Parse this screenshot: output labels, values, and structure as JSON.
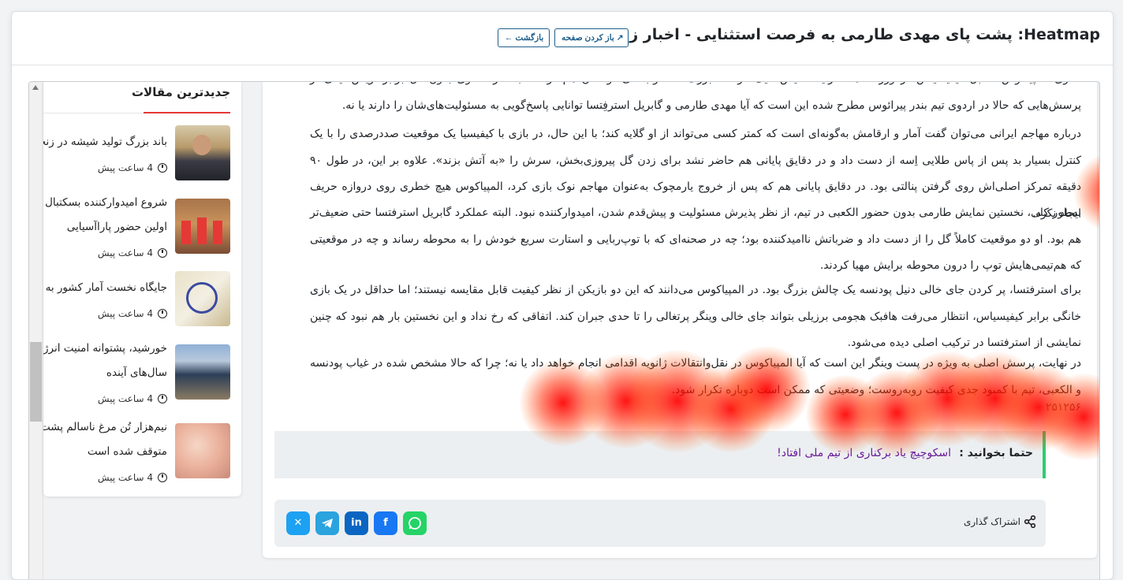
{
  "header": {
    "title": "Heatmap: پشت پای مهدی طارمی به فرصت استثنایی - اخبار زنده",
    "open_page_label": "باز کردن صفحه ↗",
    "back_label": "← بازگشت"
  },
  "sidebar": {
    "title": "جدیدترین مقالات",
    "items": [
      {
        "title": "باند بزرگ تولید شیشه در زنجا",
        "time": "4 ساعت پیش"
      },
      {
        "title": "شروع امیدوارکننده بسکتبال و",
        "title2": "اولین حضور پاراآسیایی",
        "time": "4 ساعت پیش"
      },
      {
        "title": "جایگاه نخست آمار کشور به ز",
        "time": "4 ساعت پیش"
      },
      {
        "title": "خورشید، پشتوانه امنیت انرژ",
        "title2": "سال‌های آینده",
        "time": "4 ساعت پیش"
      },
      {
        "title": "نیم‌هزار تُن مرغ ناسالم پشت",
        "title2": "متوقف شده است",
        "time": "4 ساعت پیش"
      }
    ]
  },
  "article": {
    "paragraphs": [
      "شاوی المپیاکوس مقابل کیفیسیاس در ورزشگاه «کارایسکاکیس» یک فرصت بزرگ محسوب می‌شود. آن هم درست بعد از تساوی بدون گل برابر آریس. یکی از پرسش‌هایی که حالا در اردوی تیم بندر پیرائوس مطرح شده این است که آیا مهدی طارمی و گابریل استرفِتسا توانایی پاسخ‌گویی به مسئولیت‌های‌شان را دارند یا نه.",
      "درباره مهاجم ایرانی می‌توان گفت آمار و ارقامش به‌گونه‌ای است که کمتر کسی می‌تواند از او گلایه کند؛ با این حال، در بازی با کیفیسیا یک موقعیت صددرصدی را با یک کنترل بسیار بد پس از پاس طلایی اِسه از دست داد و در دقایق پایانی هم حاضر نشد برای زدن گل پیروزی‌بخش، سرش را «به آتش بزند». علاوه بر این، در طول ۹۰ دقیقه تمرکز اصلی‌اش روی گرفتن پنالتی بود. در دقایق پایانی هم که پس از خروج یارمچوک به‌عنوان مهاجم نوک بازی کرد، المپیاکوس هیچ خطری روی دروازه حریف ایجاد نکرد.",
      "به‌طور کلی، نخستین نمایش طارمی بدون حضور الکعبی در تیم، از نظر پذیرش مسئولیت و پیش‌قدم شدن، امیدوارکننده نبود. البته عملکرد گابریل استرفتسا حتی ضعیف‌تر هم بود. او دو موقعیت کاملاً گل را از دست داد و ضرباتش ناامیدکننده بود؛ چه در صحنه‌ای که با توپ‌ربایی و استارت سریع خودش را به محوطه رساند و چه در موقعیتی که هم‌تیمی‌هایش توپ را درون محوطه برایش مهیا کردند.",
      "برای استرفتسا، پر کردن جای خالی دنیل پودنسه یک چالش بزرگ بود. در المپیاکوس می‌دانند که این دو بازیکن از نظر کیفیت قابل مقایسه نیستند؛ اما حداقل در یک بازی خانگی برابر کیفیسیاس، انتظار می‌رفت هافبک هجومی برزیلی بتواند جای خالی وینگر پرتغالی را تا حدی جبران کند. اتفاقی که رخ نداد و این نخستین بار هم نبود که چنین نمایشی از استرفتسا در ترکیب اصلی دیده می‌شود.",
      "در نهایت، پرسش اصلی به ویژه در پست وینگر این است که آیا المپیاکوس در نقل‌وانتقالات ژانویه اقدامی انجام خواهد داد یا نه؛ چرا که حالا مشخص شده در غیاب پودنسه و الکعبی، تیم با کمبود جدی کیفیت روبه‌روست؛ وضعیتی که ممکن است دوباره تکرار شود."
    ],
    "article_id": "۲۵۱۲۵۶",
    "read_also": {
      "label": "حتما بخوانید :",
      "link": "اسکوچیچ یاد برکناری از تیم ملی افتاد!"
    },
    "share": {
      "label": "اشتراک گذاری",
      "buttons": [
        "whatsapp",
        "facebook",
        "linkedin",
        "telegram",
        "x"
      ]
    }
  },
  "colors": {
    "accent_red": "#e53935",
    "read_also_border": "#2ecc71",
    "link_purple": "#6a1b9a",
    "heat": "#ff0000"
  }
}
